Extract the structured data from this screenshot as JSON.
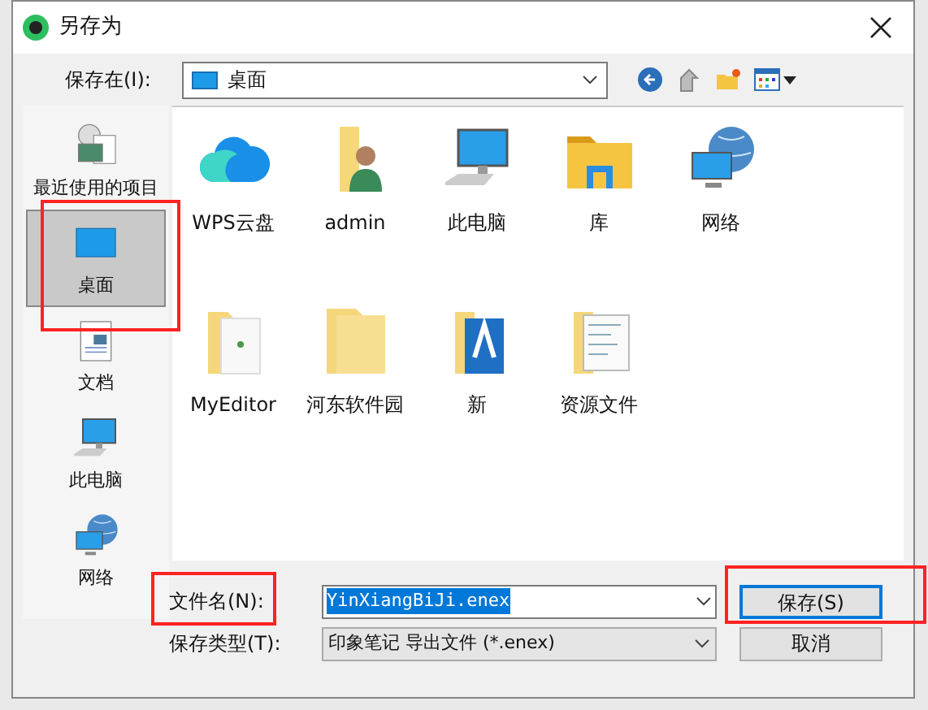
{
  "window": {
    "title": "另存为"
  },
  "save_in": {
    "label": "保存在(I):",
    "value": "桌面"
  },
  "sidebar": {
    "items": [
      {
        "label": "最近使用的项目",
        "kind": "recent",
        "selected": false
      },
      {
        "label": "桌面",
        "kind": "desktop",
        "selected": true
      },
      {
        "label": "文档",
        "kind": "document",
        "selected": false
      },
      {
        "label": "此电脑",
        "kind": "computer",
        "selected": false
      },
      {
        "label": "网络",
        "kind": "network",
        "selected": false
      }
    ]
  },
  "files": [
    {
      "name": "WPS云盘",
      "kind": "cloud"
    },
    {
      "name": "admin",
      "kind": "user-folder"
    },
    {
      "name": "此电脑",
      "kind": "computer"
    },
    {
      "name": "库",
      "kind": "library"
    },
    {
      "name": "网络",
      "kind": "network"
    },
    {
      "name": "MyEditor",
      "kind": "doc-folder"
    },
    {
      "name": "河东软件园",
      "kind": "folder"
    },
    {
      "name": "新",
      "kind": "app-folder"
    },
    {
      "name": "资源文件",
      "kind": "files-folder"
    }
  ],
  "file_name": {
    "label": "文件名(N):",
    "value": "YinXiangBiJi.enex"
  },
  "file_type": {
    "label": "保存类型(T):",
    "value": "印象笔记 导出文件 (*.enex)"
  },
  "buttons": [
    {
      "label": "保存(S)",
      "kind": "primary"
    },
    {
      "label": "取消",
      "kind": "secondary"
    }
  ]
}
